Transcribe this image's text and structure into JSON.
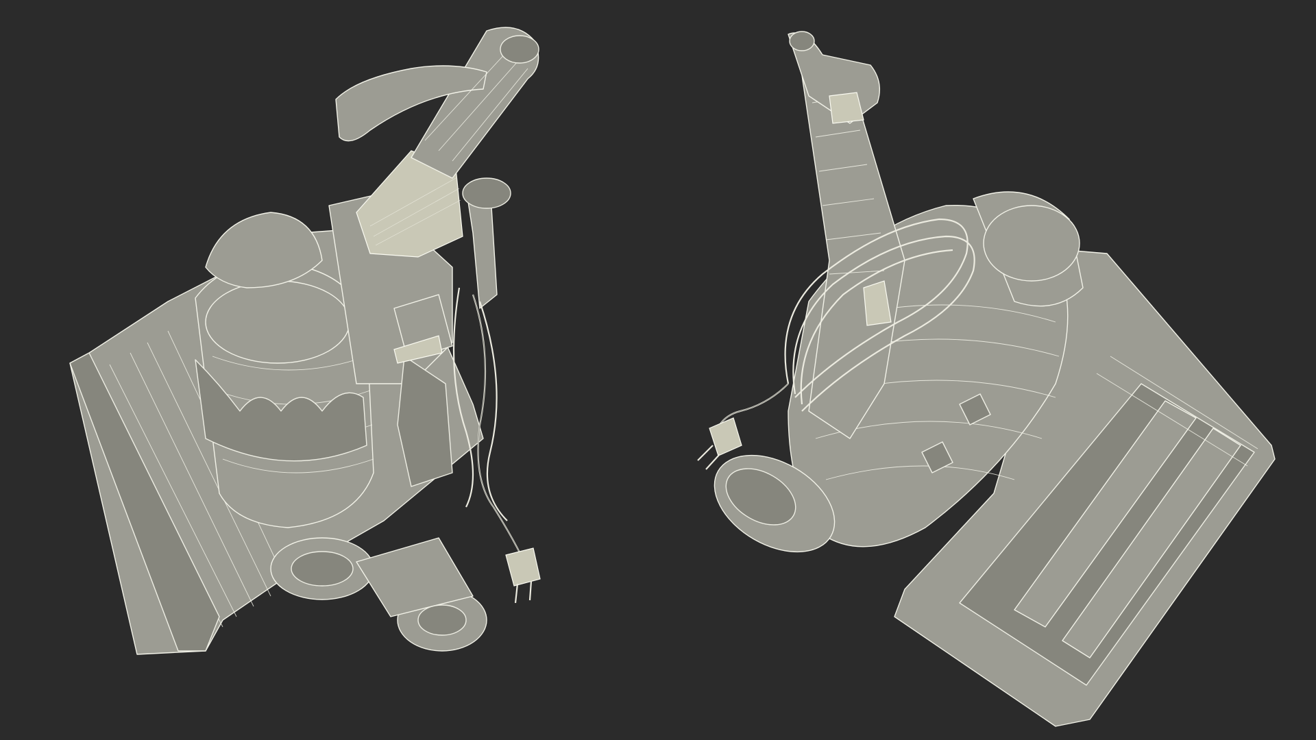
{
  "scene": {
    "background_color": "#2b2b2b",
    "wire_color": "#f2f2e8",
    "surface_color": "#9c9c93",
    "accent_color": "#c9c8b6",
    "objects": [
      {
        "id": "vacuum-left",
        "label": ""
      },
      {
        "id": "vacuum-right",
        "label": ""
      }
    ]
  }
}
